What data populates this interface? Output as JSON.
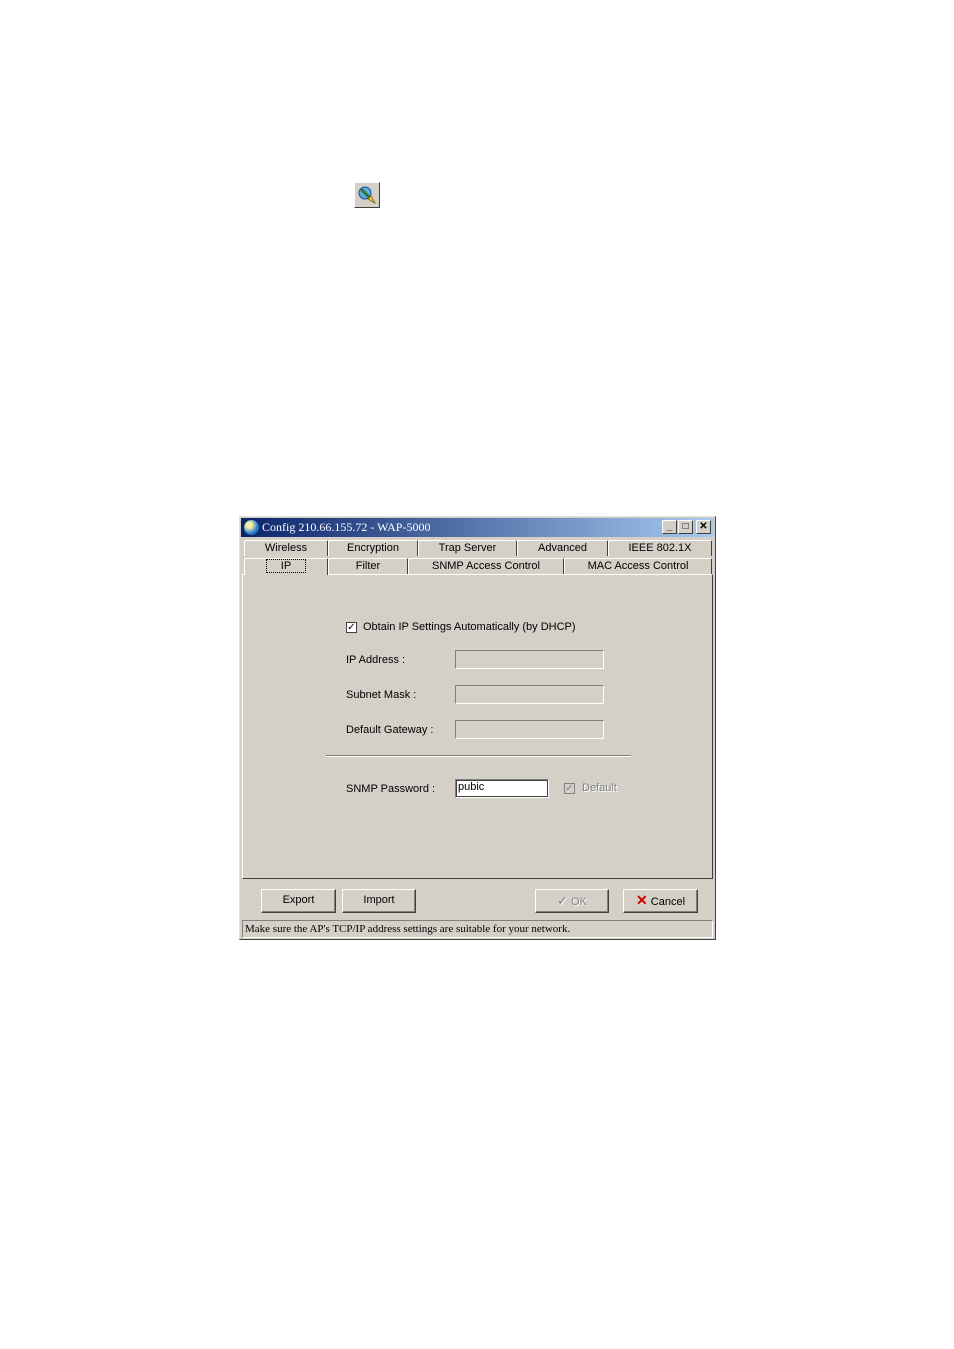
{
  "window": {
    "title": "Config 210.66.155.72 - WAP-5000",
    "minimize": "_",
    "maximize": "□",
    "close": "✕"
  },
  "tabs_row1": [
    "Wireless",
    "Encryption",
    "Trap Server",
    "Advanced",
    "IEEE 802.1X"
  ],
  "tabs_row2": [
    "IP",
    "Filter",
    "SNMP Access Control",
    "MAC Access Control"
  ],
  "active_tab": "IP",
  "ip": {
    "dhcp_label": "Obtain IP Settings Automatically (by DHCP)",
    "dhcp_checked": true,
    "ip_address_label": "IP Address :",
    "ip_address_value": "",
    "subnet_mask_label": "Subnet Mask :",
    "subnet_mask_value": "",
    "gateway_label": "Default Gateway :",
    "gateway_value": "",
    "snmp_label": "SNMP Password :",
    "snmp_value": "pubic",
    "default_label": "Default",
    "default_checked": true
  },
  "buttons": {
    "export": "Export",
    "import": "Import",
    "ok": "OK",
    "cancel": "Cancel"
  },
  "status": "Make sure the AP's TCP/IP address settings are suitable for your network.",
  "colors": {
    "titlebar_start": "#0a246a",
    "titlebar_end": "#a6caf0",
    "face": "#d4d0c8",
    "cancel_x": "#cc0000"
  }
}
